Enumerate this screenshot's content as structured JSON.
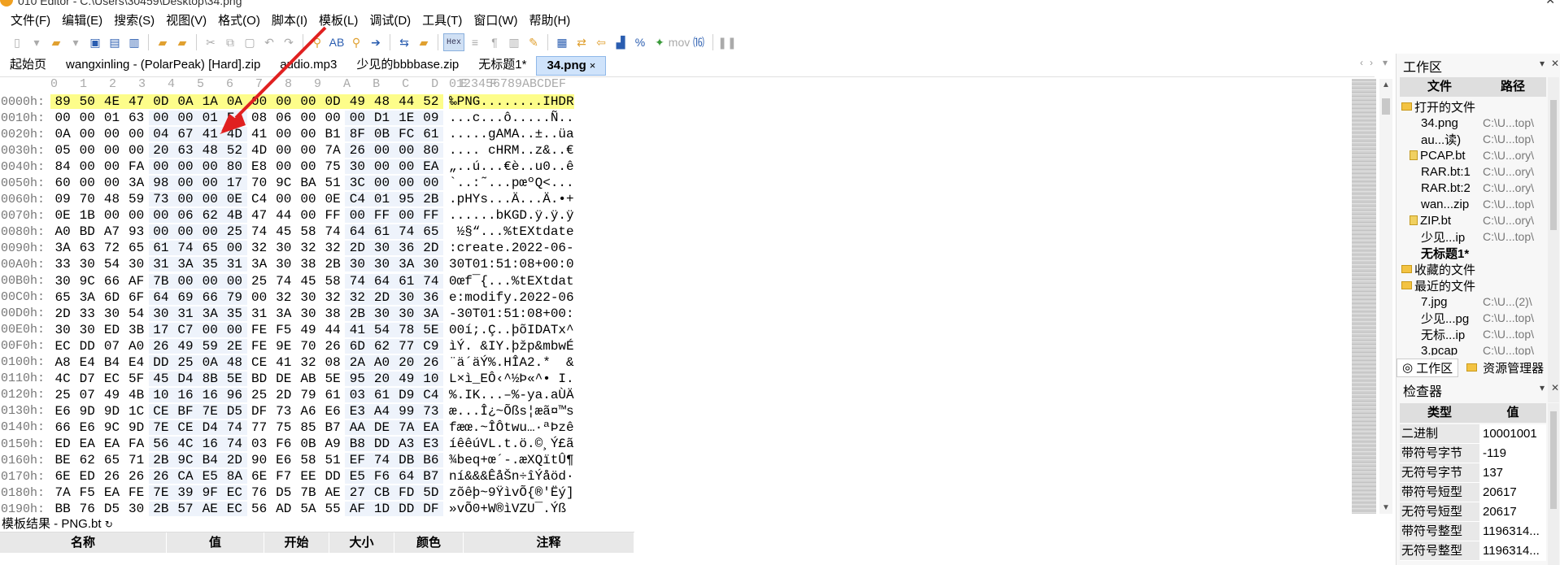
{
  "window": {
    "title": "010 Editor - C:\\Users\\30459\\Desktop\\34.png"
  },
  "menu": [
    "文件(F)",
    "编辑(E)",
    "搜索(S)",
    "视图(V)",
    "格式(O)",
    "脚本(I)",
    "模板(L)",
    "调试(D)",
    "工具(T)",
    "窗口(W)",
    "帮助(H)"
  ],
  "toolbar": {
    "hex_label": "Hex",
    "mov_label": "mov"
  },
  "tabs": [
    {
      "label": "起始页",
      "active": false
    },
    {
      "label": "wangxinling - (PolarPeak) [Hard].zip",
      "active": false
    },
    {
      "label": "audio.mp3",
      "active": false
    },
    {
      "label": "少见的bbbbase.zip",
      "active": false
    },
    {
      "label": "无标题1*",
      "active": false
    },
    {
      "label": "34.png",
      "active": true,
      "close": "×"
    }
  ],
  "editor": {
    "column_header": "0   1   2   3   4   5   6   7   8   9   A   B   C   D   E   F",
    "ascii_header": "0123456789ABCDEF",
    "rows": [
      {
        "addr": "0000h:",
        "bytes": [
          "89",
          "50",
          "4E",
          "47",
          "0D",
          "0A",
          "1A",
          "0A",
          "00",
          "00",
          "00",
          "0D",
          "49",
          "48",
          "44",
          "52"
        ],
        "ascii": "‰PNG........IHDR",
        "highlight": true
      },
      {
        "addr": "0010h:",
        "bytes": [
          "00",
          "00",
          "01",
          "63",
          "00",
          "00",
          "01",
          "F4",
          "08",
          "06",
          "00",
          "00",
          "00",
          "D1",
          "1E",
          "09"
        ],
        "ascii": "...c...ô.....Ñ.."
      },
      {
        "addr": "0020h:",
        "bytes": [
          "0A",
          "00",
          "00",
          "00",
          "04",
          "67",
          "41",
          "4D",
          "41",
          "00",
          "00",
          "B1",
          "8F",
          "0B",
          "FC",
          "61"
        ],
        "ascii": ".....gAMA..±..üa"
      },
      {
        "addr": "0030h:",
        "bytes": [
          "05",
          "00",
          "00",
          "00",
          "20",
          "63",
          "48",
          "52",
          "4D",
          "00",
          "00",
          "7A",
          "26",
          "00",
          "00",
          "80"
        ],
        "ascii": ".... cHRM..z&..€"
      },
      {
        "addr": "0040h:",
        "bytes": [
          "84",
          "00",
          "00",
          "FA",
          "00",
          "00",
          "00",
          "80",
          "E8",
          "00",
          "00",
          "75",
          "30",
          "00",
          "00",
          "EA"
        ],
        "ascii": "„..ú...€è..u0..ê"
      },
      {
        "addr": "0050h:",
        "bytes": [
          "60",
          "00",
          "00",
          "3A",
          "98",
          "00",
          "00",
          "17",
          "70",
          "9C",
          "BA",
          "51",
          "3C",
          "00",
          "00",
          "00"
        ],
        "ascii": "`..:˜...pœºQ<..."
      },
      {
        "addr": "0060h:",
        "bytes": [
          "09",
          "70",
          "48",
          "59",
          "73",
          "00",
          "00",
          "0E",
          "C4",
          "00",
          "00",
          "0E",
          "C4",
          "01",
          "95",
          "2B"
        ],
        "ascii": ".pHYs...Ä...Ä.•+"
      },
      {
        "addr": "0070h:",
        "bytes": [
          "0E",
          "1B",
          "00",
          "00",
          "00",
          "06",
          "62",
          "4B",
          "47",
          "44",
          "00",
          "FF",
          "00",
          "FF",
          "00",
          "FF"
        ],
        "ascii": "......bKGD.ÿ.ÿ.ÿ"
      },
      {
        "addr": "0080h:",
        "bytes": [
          "A0",
          "BD",
          "A7",
          "93",
          "00",
          "00",
          "00",
          "25",
          "74",
          "45",
          "58",
          "74",
          "64",
          "61",
          "74",
          "65"
        ],
        "ascii": " ½§“...%tEXtdate"
      },
      {
        "addr": "0090h:",
        "bytes": [
          "3A",
          "63",
          "72",
          "65",
          "61",
          "74",
          "65",
          "00",
          "32",
          "30",
          "32",
          "32",
          "2D",
          "30",
          "36",
          "2D"
        ],
        "ascii": ":create.2022-06-"
      },
      {
        "addr": "00A0h:",
        "bytes": [
          "33",
          "30",
          "54",
          "30",
          "31",
          "3A",
          "35",
          "31",
          "3A",
          "30",
          "38",
          "2B",
          "30",
          "30",
          "3A",
          "30"
        ],
        "ascii": "30T01:51:08+00:0"
      },
      {
        "addr": "00B0h:",
        "bytes": [
          "30",
          "9C",
          "66",
          "AF",
          "7B",
          "00",
          "00",
          "00",
          "25",
          "74",
          "45",
          "58",
          "74",
          "64",
          "61",
          "74"
        ],
        "ascii": "0œf¯{...%tEXtdat"
      },
      {
        "addr": "00C0h:",
        "bytes": [
          "65",
          "3A",
          "6D",
          "6F",
          "64",
          "69",
          "66",
          "79",
          "00",
          "32",
          "30",
          "32",
          "32",
          "2D",
          "30",
          "36"
        ],
        "ascii": "e:modify.2022-06"
      },
      {
        "addr": "00D0h:",
        "bytes": [
          "2D",
          "33",
          "30",
          "54",
          "30",
          "31",
          "3A",
          "35",
          "31",
          "3A",
          "30",
          "38",
          "2B",
          "30",
          "30",
          "3A"
        ],
        "ascii": "-30T01:51:08+00:"
      },
      {
        "addr": "00E0h:",
        "bytes": [
          "30",
          "30",
          "ED",
          "3B",
          "17",
          "C7",
          "00",
          "00",
          "FE",
          "F5",
          "49",
          "44",
          "41",
          "54",
          "78",
          "5E"
        ],
        "ascii": "00í;.Ç..þõIDATx^"
      },
      {
        "addr": "00F0h:",
        "bytes": [
          "EC",
          "DD",
          "07",
          "A0",
          "26",
          "49",
          "59",
          "2E",
          "FE",
          "9E",
          "70",
          "26",
          "6D",
          "62",
          "77",
          "C9"
        ],
        "ascii": "ìÝ. &IY.þžp&mbwÉ"
      },
      {
        "addr": "0100h:",
        "bytes": [
          "A8",
          "E4",
          "B4",
          "E4",
          "DD",
          "25",
          "0A",
          "48",
          "CE",
          "41",
          "32",
          "08",
          "2A",
          "A0",
          "20",
          "26"
        ],
        "ascii": "¨ä´äÝ%.HÎA2.*  &"
      },
      {
        "addr": "0110h:",
        "bytes": [
          "4C",
          "D7",
          "EC",
          "5F",
          "45",
          "D4",
          "8B",
          "5E",
          "BD",
          "DE",
          "AB",
          "5E",
          "95",
          "20",
          "49",
          "10"
        ],
        "ascii": "L×ì_EÔ‹^½Þ«^• I."
      },
      {
        "addr": "0120h:",
        "bytes": [
          "25",
          "07",
          "49",
          "4B",
          "10",
          "16",
          "16",
          "96",
          "25",
          "2D",
          "79",
          "61",
          "03",
          "61",
          "D9",
          "C4"
        ],
        "ascii": "%.IK...–%-ya.aÙÄ"
      },
      {
        "addr": "0130h:",
        "bytes": [
          "E6",
          "9D",
          "9D",
          "1C",
          "CE",
          "BF",
          "7E",
          "D5",
          "DF",
          "73",
          "A6",
          "E6",
          "E3",
          "A4",
          "99",
          "73"
        ],
        "ascii": "æ...Î¿~Õßs¦æã¤™s"
      },
      {
        "addr": "0140h:",
        "bytes": [
          "66",
          "E6",
          "9C",
          "9D",
          "7E",
          "CE",
          "D4",
          "74",
          "77",
          "75",
          "85",
          "B7",
          "AA",
          "DE",
          "7A",
          "EA"
        ],
        "ascii": "fæœ.~ÎÔtwu…·ªÞzê"
      },
      {
        "addr": "0150h:",
        "bytes": [
          "ED",
          "EA",
          "EA",
          "FA",
          "56",
          "4C",
          "16",
          "74",
          "03",
          "F6",
          "0B",
          "A9",
          "B8",
          "DD",
          "A3",
          "E3"
        ],
        "ascii": "íêêúVL.t.ö.©¸Ý£ã"
      },
      {
        "addr": "0160h:",
        "bytes": [
          "BE",
          "62",
          "65",
          "71",
          "2B",
          "9C",
          "B4",
          "2D",
          "90",
          "E6",
          "58",
          "51",
          "EF",
          "74",
          "DB",
          "B6"
        ],
        "ascii": "¾beq+œ´-.æXQïtÛ¶"
      },
      {
        "addr": "0170h:",
        "bytes": [
          "6E",
          "ED",
          "26",
          "26",
          "26",
          "CA",
          "E5",
          "8A",
          "6E",
          "F7",
          "EE",
          "DD",
          "E5",
          "F6",
          "64",
          "B7"
        ],
        "ascii": "ní&&&ÊåŠn÷îÝåöd·"
      },
      {
        "addr": "0180h:",
        "bytes": [
          "7A",
          "F5",
          "EA",
          "FE",
          "7E",
          "39",
          "9F",
          "EC",
          "76",
          "D5",
          "7B",
          "AE",
          "27",
          "CB",
          "FD",
          "5D"
        ],
        "ascii": "zõêþ~9ŸìvÕ{®'Ëý]"
      },
      {
        "addr": "0190h:",
        "bytes": [
          "BB",
          "76",
          "D5",
          "30",
          "2B",
          "57",
          "AE",
          "EC",
          "56",
          "AD",
          "5A",
          "55",
          "AF",
          "1D",
          "DD",
          "DF"
        ],
        "ascii": "»vÕ0+W®ìV­ZU¯.Ýß"
      }
    ]
  },
  "template_results": {
    "title": "模板结果 - PNG.bt",
    "columns": [
      "名称",
      "值",
      "开始",
      "大小",
      "颜色",
      "注释"
    ]
  },
  "workspace": {
    "title": "工作区",
    "columns": [
      "文件",
      "路径"
    ],
    "items": [
      {
        "type": "group",
        "name": "打开的文件"
      },
      {
        "type": "file",
        "name": "34.png",
        "path": "C:\\U...top\\"
      },
      {
        "type": "file",
        "name": "au...读)",
        "path": "C:\\U...top\\"
      },
      {
        "type": "tfile",
        "name": "PCAP.bt",
        "path": "C:\\U...ory\\"
      },
      {
        "type": "file",
        "name": "RAR.bt:1",
        "path": "C:\\U...ory\\"
      },
      {
        "type": "file",
        "name": "RAR.bt:2",
        "path": "C:\\U...ory\\"
      },
      {
        "type": "file",
        "name": "wan...zip",
        "path": "C:\\U...top\\"
      },
      {
        "type": "tfile",
        "name": "ZIP.bt",
        "path": "C:\\U...ory\\"
      },
      {
        "type": "file",
        "name": "少见...ip",
        "path": "C:\\U...top\\"
      },
      {
        "type": "file",
        "name": "无标题1*",
        "path": "",
        "bold": true
      },
      {
        "type": "group",
        "name": "收藏的文件"
      },
      {
        "type": "group",
        "name": "最近的文件"
      },
      {
        "type": "file",
        "name": "7.jpg",
        "path": "C:\\U...(2)\\"
      },
      {
        "type": "file",
        "name": "少见...pg",
        "path": "C:\\U...top\\"
      },
      {
        "type": "file",
        "name": "无标...ip",
        "path": "C:\\U...top\\"
      },
      {
        "type": "file",
        "name": "3.pcap",
        "path": "C:\\U...top\\"
      }
    ],
    "tabs": [
      "工作区",
      "资源管理器"
    ]
  },
  "inspector": {
    "title": "检查器",
    "columns": [
      "类型",
      "值"
    ],
    "rows": [
      {
        "type": "二进制",
        "value": "10001001"
      },
      {
        "type": "带符号字节",
        "value": "-119"
      },
      {
        "type": "无符号字节",
        "value": "137"
      },
      {
        "type": "带符号短型",
        "value": "20617"
      },
      {
        "type": "无符号短型",
        "value": "20617"
      },
      {
        "type": "带符号整型",
        "value": "1196314..."
      },
      {
        "type": "无符号整型",
        "value": "1196314..."
      }
    ]
  }
}
